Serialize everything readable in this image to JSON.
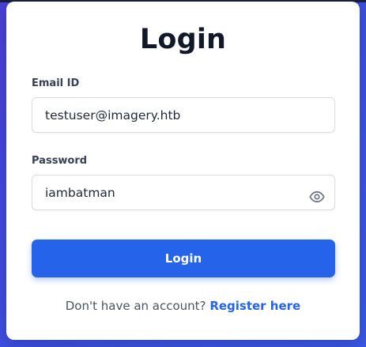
{
  "form": {
    "title": "Login",
    "email": {
      "label": "Email ID",
      "value": "testuser@imagery.htb"
    },
    "password": {
      "label": "Password",
      "value": "iambatman",
      "toggle_icon": "eye-icon"
    },
    "submit_label": "Login",
    "footer": {
      "prompt": "Don't have an account?",
      "link_label": "Register here"
    }
  },
  "colors": {
    "accent": "#2563eb",
    "background_gradient_start": "#4a3fd6",
    "background_gradient_end": "#3a57e6",
    "card": "#ffffff",
    "title_text": "#111827"
  }
}
